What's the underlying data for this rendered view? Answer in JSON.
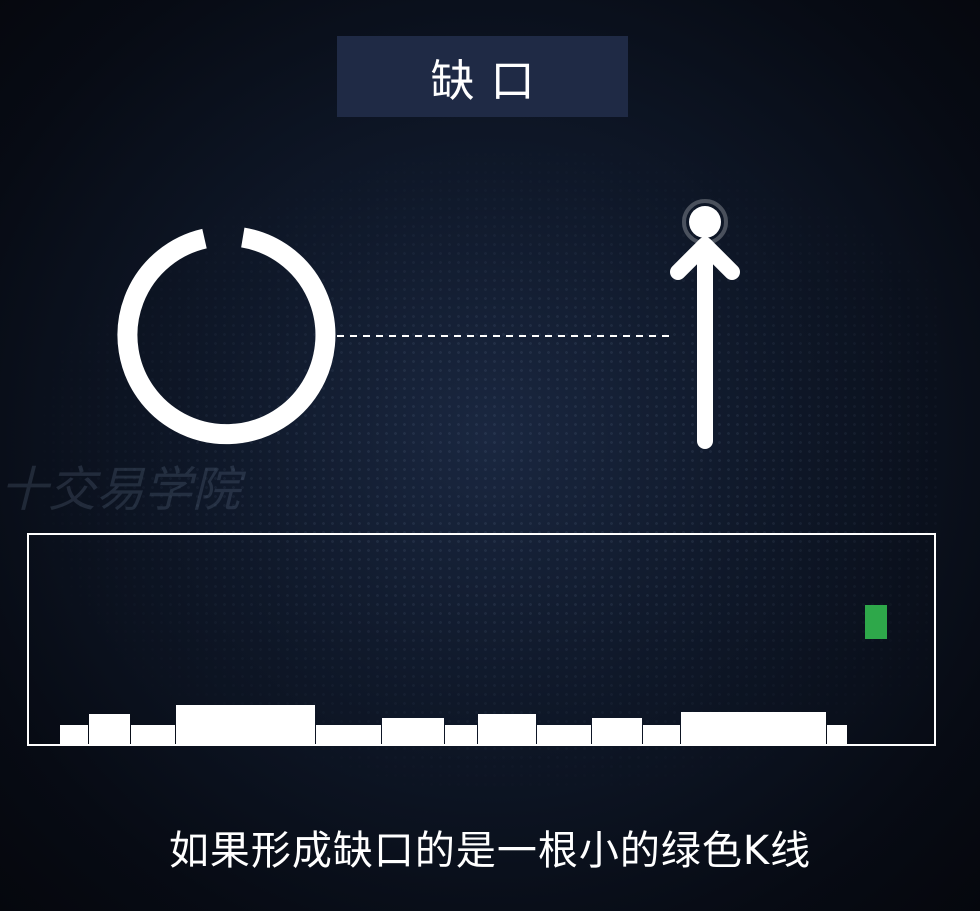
{
  "title": "缺口",
  "watermark": "十交易学院",
  "subtitle": "如果形成缺口的是一根小的绿色K线",
  "colors": {
    "background": "#0f1829",
    "title_box": "#1f2a45",
    "foreground": "#ffffff",
    "green_candle": "#2ea84a"
  },
  "icons": {
    "gap_ring": "open-ring-icon",
    "up_arrow": "arrow-up-icon"
  }
}
